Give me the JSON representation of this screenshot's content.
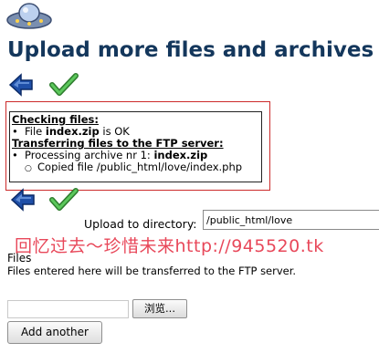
{
  "header": {
    "title": "Upload more files and archives",
    "logo_icon": "ufo-icon"
  },
  "toolbar_top": {
    "back_icon": "back-arrow-icon",
    "ok_icon": "checkmark-icon"
  },
  "status": {
    "checking_heading": "Checking files:",
    "check_item_prefix": "File ",
    "check_item_file": "index.zip",
    "check_item_suffix": " is OK",
    "transfer_heading": "Transferring files to the FTP server:",
    "transfer_item_prefix": "Processing archive nr 1: ",
    "transfer_item_file": "index.zip",
    "copied_item": "Copied file /public_html/love/index.php"
  },
  "upload": {
    "label": "Upload to directory:",
    "directory_value": "/public_html/love"
  },
  "watermark": "回忆过去～珍惜未来http://945520.tk",
  "files": {
    "label": "Files",
    "description": "Files entered here will be transferred to the FTP server.",
    "browse_label": "浏览...",
    "add_another_label": "Add another"
  },
  "colors": {
    "title": "#14375c",
    "accent_arrow": "#1f4fa8",
    "check_green": "#3aa43a",
    "highlight_border": "#cc2a2a",
    "watermark": "#e8485a"
  }
}
